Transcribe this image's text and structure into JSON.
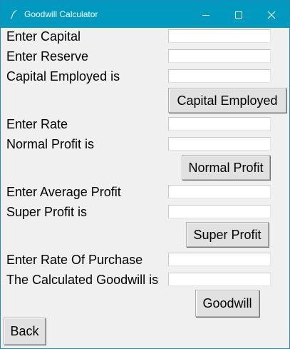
{
  "window": {
    "title": "Goodwill Calculator"
  },
  "labels": {
    "capital": "Enter Capital",
    "reserve": "Enter Reserve",
    "capital_employed_is": "Capital Employed is",
    "rate": "Enter Rate",
    "normal_profit_is": "Normal Profit is",
    "average_profit": "Enter Average Profit",
    "super_profit_is": "Super Profit is",
    "rate_of_purchase": "Enter Rate Of Purchase",
    "goodwill_is": "The Calculated Goodwill is"
  },
  "fields": {
    "capital": "",
    "reserve": "",
    "capital_employed": "",
    "rate": "",
    "normal_profit": "",
    "average_profit": "",
    "super_profit": "",
    "rate_of_purchase": "",
    "goodwill": ""
  },
  "buttons": {
    "capital_employed": "Capital Employed",
    "normal_profit": "Normal Profit",
    "super_profit": "Super Profit",
    "goodwill": "Goodwill",
    "back": "Back"
  },
  "icons": {
    "app": "feather-icon",
    "minimize": "minimize-icon",
    "maximize": "maximize-icon",
    "close": "close-icon"
  },
  "colors": {
    "titlebar": "#0099bf",
    "background": "#f0f0f0",
    "button_face": "#e1e1e1"
  }
}
